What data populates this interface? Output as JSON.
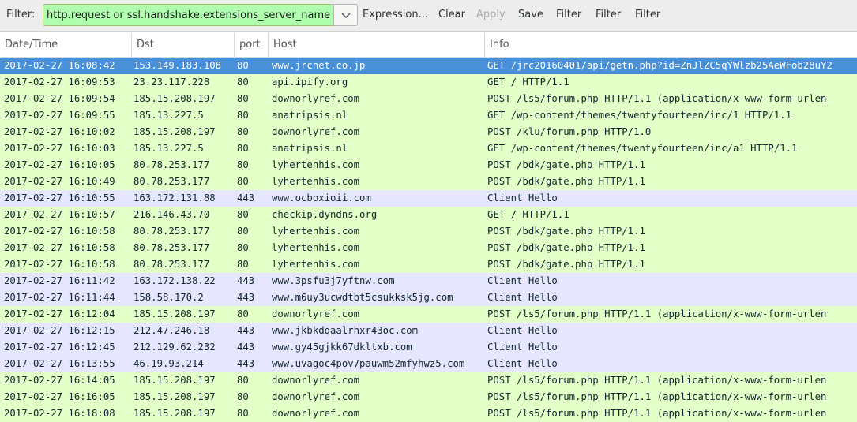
{
  "toolbar": {
    "filter_label": "Filter:",
    "filter_value": "http.request or ssl.handshake.extensions_server_name",
    "expression_label": "Expression...",
    "clear_label": "Clear",
    "apply_label": "Apply",
    "save_label": "Save",
    "filter_btn_1": "Filter",
    "filter_btn_2": "Filter",
    "filter_btn_3": "Filter"
  },
  "columns": [
    "Date/Time",
    "Dst",
    "port",
    "Host",
    "Info"
  ],
  "colors": {
    "http_row": "#e4ffc7",
    "tls_row": "#e7e6ff",
    "selected_row": "#4a90d9",
    "filter_valid": "#afffaf"
  },
  "rows": [
    {
      "time": "2017-02-27 16:08:42",
      "dst": "153.149.183.108",
      "port": "80",
      "host": "www.jrcnet.co.jp",
      "info": "GET /jrc20160401/api/getn.php?id=ZnJlZC5qYWlzb25AeWFob28uY2",
      "type": "selected"
    },
    {
      "time": "2017-02-27 16:09:53",
      "dst": "23.23.117.228",
      "port": "80",
      "host": "api.ipify.org",
      "info": "GET / HTTP/1.1",
      "type": "http"
    },
    {
      "time": "2017-02-27 16:09:54",
      "dst": "185.15.208.197",
      "port": "80",
      "host": "downorlyref.com",
      "info": "POST /ls5/forum.php HTTP/1.1  (application/x-www-form-urlen",
      "type": "http"
    },
    {
      "time": "2017-02-27 16:09:55",
      "dst": "185.13.227.5",
      "port": "80",
      "host": "anatripsis.nl",
      "info": "GET /wp-content/themes/twentyfourteen/inc/1 HTTP/1.1",
      "type": "http"
    },
    {
      "time": "2017-02-27 16:10:02",
      "dst": "185.15.208.197",
      "port": "80",
      "host": "downorlyref.com",
      "info": "POST /klu/forum.php HTTP/1.0",
      "type": "http"
    },
    {
      "time": "2017-02-27 16:10:03",
      "dst": "185.13.227.5",
      "port": "80",
      "host": "anatripsis.nl",
      "info": "GET /wp-content/themes/twentyfourteen/inc/a1 HTTP/1.1",
      "type": "http"
    },
    {
      "time": "2017-02-27 16:10:05",
      "dst": "80.78.253.177",
      "port": "80",
      "host": "lyhertenhis.com",
      "info": "POST /bdk/gate.php HTTP/1.1",
      "type": "http"
    },
    {
      "time": "2017-02-27 16:10:49",
      "dst": "80.78.253.177",
      "port": "80",
      "host": "lyhertenhis.com",
      "info": "POST /bdk/gate.php HTTP/1.1",
      "type": "http"
    },
    {
      "time": "2017-02-27 16:10:55",
      "dst": "163.172.131.88",
      "port": "443",
      "host": "www.ocboxioii.com",
      "info": "Client Hello",
      "type": "tls"
    },
    {
      "time": "2017-02-27 16:10:57",
      "dst": "216.146.43.70",
      "port": "80",
      "host": "checkip.dyndns.org",
      "info": "GET / HTTP/1.1",
      "type": "http"
    },
    {
      "time": "2017-02-27 16:10:58",
      "dst": "80.78.253.177",
      "port": "80",
      "host": "lyhertenhis.com",
      "info": "POST /bdk/gate.php HTTP/1.1",
      "type": "http"
    },
    {
      "time": "2017-02-27 16:10:58",
      "dst": "80.78.253.177",
      "port": "80",
      "host": "lyhertenhis.com",
      "info": "POST /bdk/gate.php HTTP/1.1",
      "type": "http"
    },
    {
      "time": "2017-02-27 16:10:58",
      "dst": "80.78.253.177",
      "port": "80",
      "host": "lyhertenhis.com",
      "info": "POST /bdk/gate.php HTTP/1.1",
      "type": "http"
    },
    {
      "time": "2017-02-27 16:11:42",
      "dst": "163.172.138.22",
      "port": "443",
      "host": "www.3psfu3j7yftnw.com",
      "info": "Client Hello",
      "type": "tls"
    },
    {
      "time": "2017-02-27 16:11:44",
      "dst": "158.58.170.2",
      "port": "443",
      "host": "www.m6uy3ucwdtbt5csukksk5jg.com",
      "info": "Client Hello",
      "type": "tls"
    },
    {
      "time": "2017-02-27 16:12:04",
      "dst": "185.15.208.197",
      "port": "80",
      "host": "downorlyref.com",
      "info": "POST /ls5/forum.php HTTP/1.1  (application/x-www-form-urlen",
      "type": "http"
    },
    {
      "time": "2017-02-27 16:12:15",
      "dst": "212.47.246.18",
      "port": "443",
      "host": "www.jkbkdqaalrhxr43oc.com",
      "info": "Client Hello",
      "type": "tls"
    },
    {
      "time": "2017-02-27 16:12:45",
      "dst": "212.129.62.232",
      "port": "443",
      "host": "www.gy45gjkk67dkltxb.com",
      "info": "Client Hello",
      "type": "tls"
    },
    {
      "time": "2017-02-27 16:13:55",
      "dst": "46.19.93.214",
      "port": "443",
      "host": "www.uvagoc4pov7pauwm52mfyhwz5.com",
      "info": "Client Hello",
      "type": "tls"
    },
    {
      "time": "2017-02-27 16:14:05",
      "dst": "185.15.208.197",
      "port": "80",
      "host": "downorlyref.com",
      "info": "POST /ls5/forum.php HTTP/1.1  (application/x-www-form-urlen",
      "type": "http"
    },
    {
      "time": "2017-02-27 16:16:05",
      "dst": "185.15.208.197",
      "port": "80",
      "host": "downorlyref.com",
      "info": "POST /ls5/forum.php HTTP/1.1  (application/x-www-form-urlen",
      "type": "http"
    },
    {
      "time": "2017-02-27 16:18:08",
      "dst": "185.15.208.197",
      "port": "80",
      "host": "downorlyref.com",
      "info": "POST /ls5/forum.php HTTP/1.1  (application/x-www-form-urlen",
      "type": "http"
    }
  ]
}
